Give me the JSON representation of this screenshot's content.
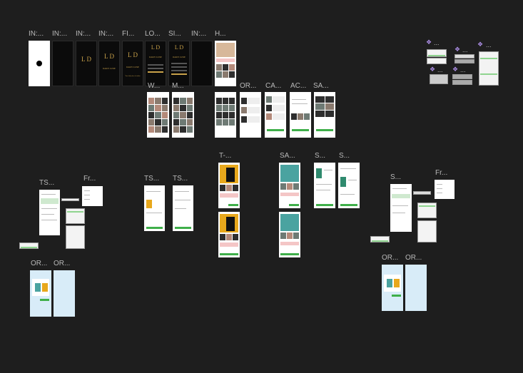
{
  "frames": {
    "in1": "IN:...",
    "in2": "IN:...",
    "in3": "IN:...",
    "in4": "IN:...",
    "fi": "FI...",
    "lo": "LO...",
    "si": "SI...",
    "in5": "IN:...",
    "h": "H...",
    "w": "W...",
    "m": "M...",
    "or1": "OR...",
    "ca": "CA...",
    "ac": "AC...",
    "sa1": "SA...",
    "t": "T-...",
    "sa2": "SA...",
    "s1": "S...",
    "s2": "S...",
    "ts1": "TS...",
    "fr1": "Fr...",
    "ts2": "TS...",
    "ts3": "TS...",
    "s3": "S...",
    "fr2": "Fr...",
    "or2": "OR...",
    "or3": "OR...",
    "or4": "OR...",
    "or5": "OR..."
  },
  "components": {
    "c1": "...",
    "c2": "...",
    "c3": "...",
    "c4": "...",
    "c5": "..."
  },
  "logo": {
    "monogram": "L D",
    "brand": "DAILY LUXE",
    "tagline": "Your daily dose of fashion"
  },
  "colors": {
    "canvas": "#1e1e1e",
    "accent_gold": "#c9a24a",
    "accent_green": "#3faf4a",
    "component_purple": "#a88be0"
  },
  "icons": [
    "component-icon"
  ]
}
